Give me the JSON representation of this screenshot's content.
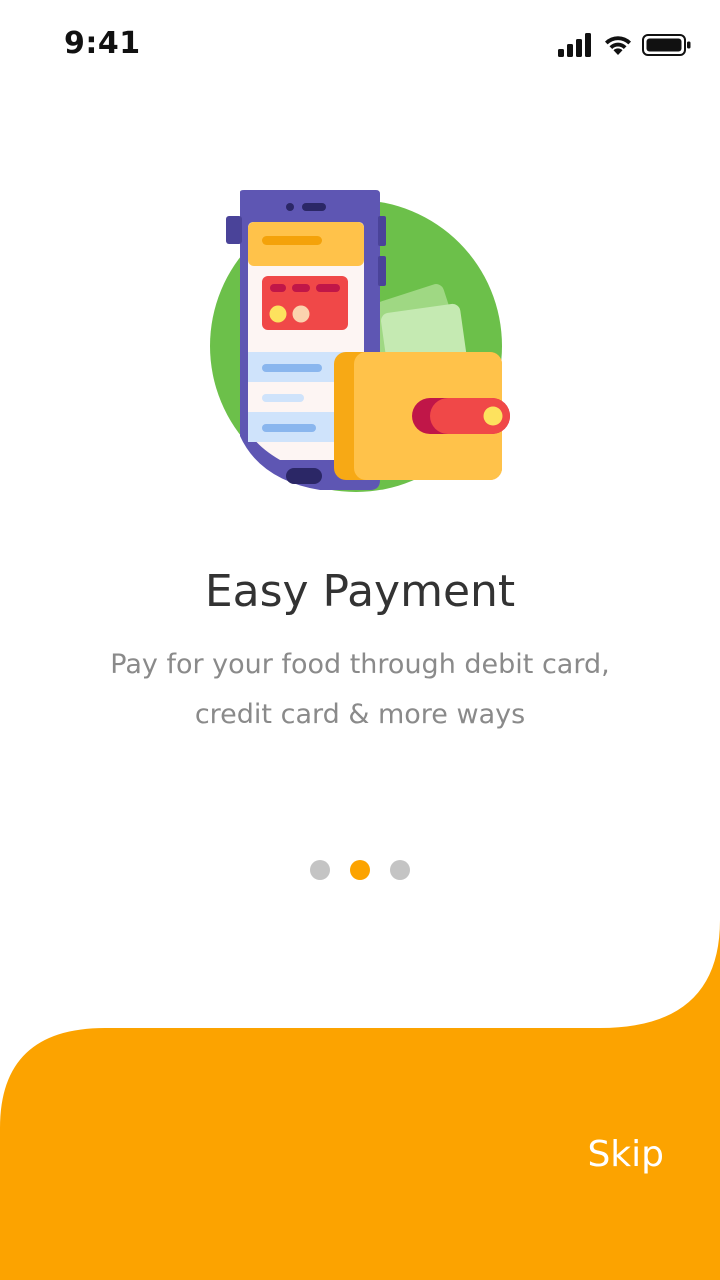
{
  "status_bar": {
    "time": "9:41",
    "icons": [
      "cellular-signal-icon",
      "wifi-icon",
      "battery-icon"
    ]
  },
  "illustration": {
    "icon": "mobile-wallet-payment-illustration"
  },
  "onboarding": {
    "title": "Easy Payment",
    "subtitle_lines": [
      "Pay for your food through debit card,",
      "credit card  & more ways"
    ],
    "pages_total": 3,
    "active_page": 2
  },
  "footer": {
    "skip_label": "Skip"
  },
  "colors": {
    "accent": "#fca300",
    "dot_inactive": "#c4c4c4",
    "title": "#333333",
    "subtitle": "#8a8a8a"
  }
}
